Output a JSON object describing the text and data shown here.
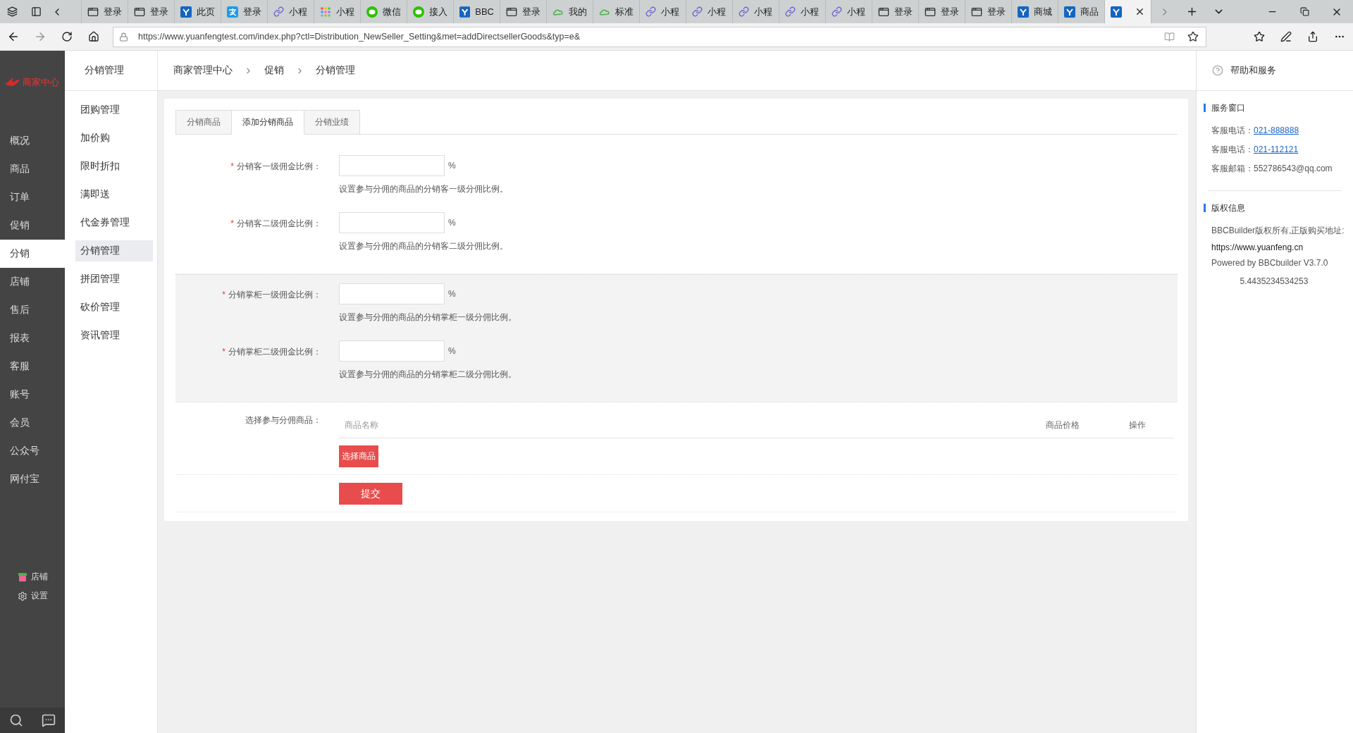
{
  "browser": {
    "tabs": [
      {
        "kind": "page",
        "label": "登录",
        "selected": false
      },
      {
        "kind": "page",
        "label": "登录",
        "selected": false
      },
      {
        "kind": "y",
        "label": "此页",
        "selected": false
      },
      {
        "kind": "alipay",
        "label": "登录",
        "selected": false
      },
      {
        "kind": "link",
        "label": "小程",
        "selected": false
      },
      {
        "kind": "dots",
        "label": "小程",
        "selected": false
      },
      {
        "kind": "wechat",
        "label": "微信",
        "selected": false
      },
      {
        "kind": "wechat",
        "label": "接入",
        "selected": false
      },
      {
        "kind": "y",
        "label": "BBC",
        "selected": false
      },
      {
        "kind": "page",
        "label": "登录",
        "selected": false
      },
      {
        "kind": "cloud",
        "label": "我的",
        "selected": false
      },
      {
        "kind": "cloud",
        "label": "标准",
        "selected": false
      },
      {
        "kind": "link",
        "label": "小程",
        "selected": false
      },
      {
        "kind": "link",
        "label": "小程",
        "selected": false
      },
      {
        "kind": "link",
        "label": "小程",
        "selected": false
      },
      {
        "kind": "link",
        "label": "小程",
        "selected": false
      },
      {
        "kind": "link",
        "label": "小程",
        "selected": false
      },
      {
        "kind": "page",
        "label": "登录",
        "selected": false
      },
      {
        "kind": "page",
        "label": "登录",
        "selected": false
      },
      {
        "kind": "page",
        "label": "登录",
        "selected": false
      },
      {
        "kind": "y",
        "label": "商城",
        "selected": false
      },
      {
        "kind": "y",
        "label": "商品",
        "selected": false
      },
      {
        "kind": "y",
        "selected": true
      }
    ],
    "address": "https://www.yuanfengtest.com/index.php?ctl=Distribution_NewSeller_Setting&met=addDirectsellerGoods&typ=e&"
  },
  "sidebar": {
    "logo": "商家中心",
    "items": [
      {
        "label": "概况",
        "selected": false
      },
      {
        "label": "商品",
        "selected": false
      },
      {
        "label": "订单",
        "selected": false
      },
      {
        "label": "促销",
        "selected": false
      },
      {
        "label": "分销",
        "selected": true
      },
      {
        "label": "店铺",
        "selected": false
      },
      {
        "label": "售后",
        "selected": false
      },
      {
        "label": "报表",
        "selected": false
      },
      {
        "label": "客服",
        "selected": false
      },
      {
        "label": "账号",
        "selected": false
      },
      {
        "label": "会员",
        "selected": false
      },
      {
        "label": "公众号",
        "selected": false
      },
      {
        "label": "网付宝",
        "selected": false
      }
    ],
    "bottom_links": [
      {
        "kind": "store",
        "label": "店铺"
      },
      {
        "kind": "settings",
        "label": "设置"
      }
    ]
  },
  "submenu": {
    "title": "分销管理",
    "items": [
      {
        "label": "团购管理",
        "selected": false
      },
      {
        "label": "加价购",
        "selected": false
      },
      {
        "label": "限时折扣",
        "selected": false
      },
      {
        "label": "满即送",
        "selected": false
      },
      {
        "label": "代金券管理",
        "selected": false
      },
      {
        "label": "分销管理",
        "selected": true
      },
      {
        "label": "拼团管理",
        "selected": false
      },
      {
        "label": "砍价管理",
        "selected": false
      },
      {
        "label": "资讯管理",
        "selected": false
      }
    ]
  },
  "breadcrumb": [
    "商家管理中心",
    "促销",
    "分销管理"
  ],
  "tabs": [
    {
      "label": "分销商品",
      "selected": false
    },
    {
      "label": "添加分销商品",
      "selected": true
    },
    {
      "label": "分销业绩",
      "selected": false
    }
  ],
  "form": {
    "groups": [
      {
        "shaded": false,
        "fields": [
          {
            "required_mark": "*",
            "label": "分销客一级佣金比例：",
            "unit": "%",
            "hint": "设置参与分佣的商品的分销客一级分佣比例。"
          },
          {
            "required_mark": "*",
            "label": "分销客二级佣金比例：",
            "unit": "%",
            "hint": "设置参与分佣的商品的分销客二级分佣比例。"
          }
        ]
      },
      {
        "shaded": true,
        "fields": [
          {
            "required_mark": "*",
            "label": "分销掌柜一级佣金比例：",
            "unit": "%",
            "hint": "设置参与分佣的商品的分销掌柜一级分佣比例。"
          },
          {
            "required_mark": "*",
            "label": "分销掌柜二级佣金比例：",
            "unit": "%",
            "hint": "设置参与分佣的商品的分销掌柜二级分佣比例。"
          }
        ]
      }
    ],
    "goods": {
      "label": "选择参与分佣商品：",
      "columns": [
        "商品名称",
        "商品价格",
        "操作"
      ],
      "button": "选择商品"
    },
    "submit": "提交"
  },
  "help": {
    "title": "帮助和服务",
    "service": {
      "title": "服务窗口",
      "rows": [
        {
          "label": "客服电话：",
          "link": "021-888888"
        },
        {
          "label": "客服电话：",
          "link": "021-112121"
        },
        {
          "label": "客服邮箱：",
          "value": "552786543@qq.com"
        }
      ]
    },
    "copyright": {
      "title": "版权信息",
      "lines": [
        "BBCBuilder版权所有,正版购买地址:",
        "https://www.yuanfeng.cn",
        "Powered by BBCbuilder V3.7.0"
      ],
      "number": "5.4435234534253"
    }
  }
}
